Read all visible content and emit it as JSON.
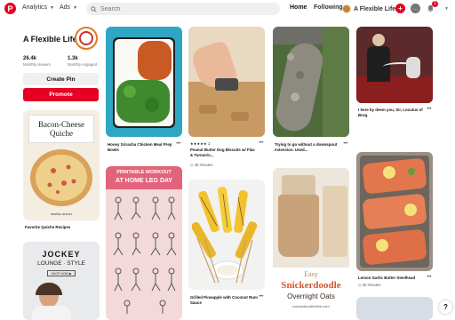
{
  "header": {
    "nav": [
      "Analytics",
      "Ads"
    ],
    "search_placeholder": "Search",
    "links": [
      "Home",
      "Following"
    ],
    "profile_name": "A Flexible Life",
    "notification_count": "1"
  },
  "profile": {
    "name": "A Flexible Life",
    "stats": [
      {
        "value": "26.4k",
        "label": "Monthly viewers"
      },
      {
        "value": "1.3k",
        "label": "Monthly engaged"
      }
    ],
    "create_pin": "Create Pin",
    "promote": "Promote"
  },
  "pins": [
    {
      "title": "Favorite Quiche Recipes",
      "image_text": "Bacon-Cheese Quiche",
      "image_sub": "martha stewart"
    },
    {
      "title": "",
      "image_text": "JOCKEY",
      "image_sub": "LOUNGE · STYLE",
      "image_cta": "SHOP NOW ▶"
    },
    {
      "title": "Honey Sriracha Chicken Meal Prep Bowls"
    },
    {
      "title": "",
      "image_text": "PRINTABLE WORKOUT",
      "image_sub": "AT HOME LEG DAY"
    },
    {
      "title": "Peanut Butter Dog Biscuits w/ Flax & Turmeric...",
      "rating": "★★★★★",
      "rating_count": "1",
      "time": "45 minutes"
    },
    {
      "title": "Grilled Pineapple with Coconut Rum Sauce"
    },
    {
      "title": "Trying to go without a downspout extension. Used..."
    },
    {
      "title": "",
      "image_text": "Easy",
      "image_sub": "Snickerdoodle",
      "image_sub2": "Overnight Oats",
      "image_url": "loveandfoodforfive.com"
    },
    {
      "title": "I here by deem you, Sir, Locutus of Borg."
    },
    {
      "title": "Lemon Garlic Butter Steelhead",
      "time": "30 minutes"
    }
  ]
}
